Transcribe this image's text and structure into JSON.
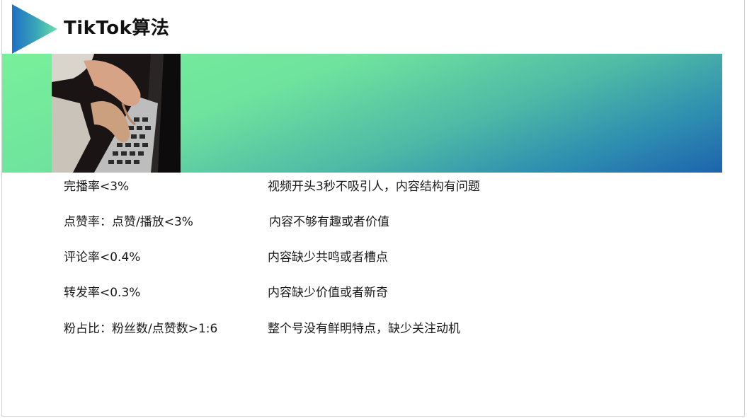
{
  "slide": {
    "title": "TikTok算法",
    "colors": {
      "banner_start": "#78f09a",
      "banner_end": "#1d63ae",
      "arrow_start": "#2f8fd6",
      "arrow_end": "#6ce0a8"
    },
    "photo_icon": "typing-on-laptop-photo",
    "rows": [
      {
        "metric": "完播率<3%",
        "reason": "视频开头3秒不吸引人，内容结构有问题"
      },
      {
        "metric": "点赞率：点赞/播放<3%",
        "reason": "内容不够有趣或者价值"
      },
      {
        "metric": "评论率<0.4%",
        "reason": "内容缺少共鸣或者槽点"
      },
      {
        "metric": "转发率<0.3%",
        "reason": "内容缺少价值或者新奇"
      },
      {
        "metric": "粉占比：粉丝数/点赞数>1:6",
        "reason": "整个号没有鲜明特点，缺少关注动机"
      }
    ]
  }
}
